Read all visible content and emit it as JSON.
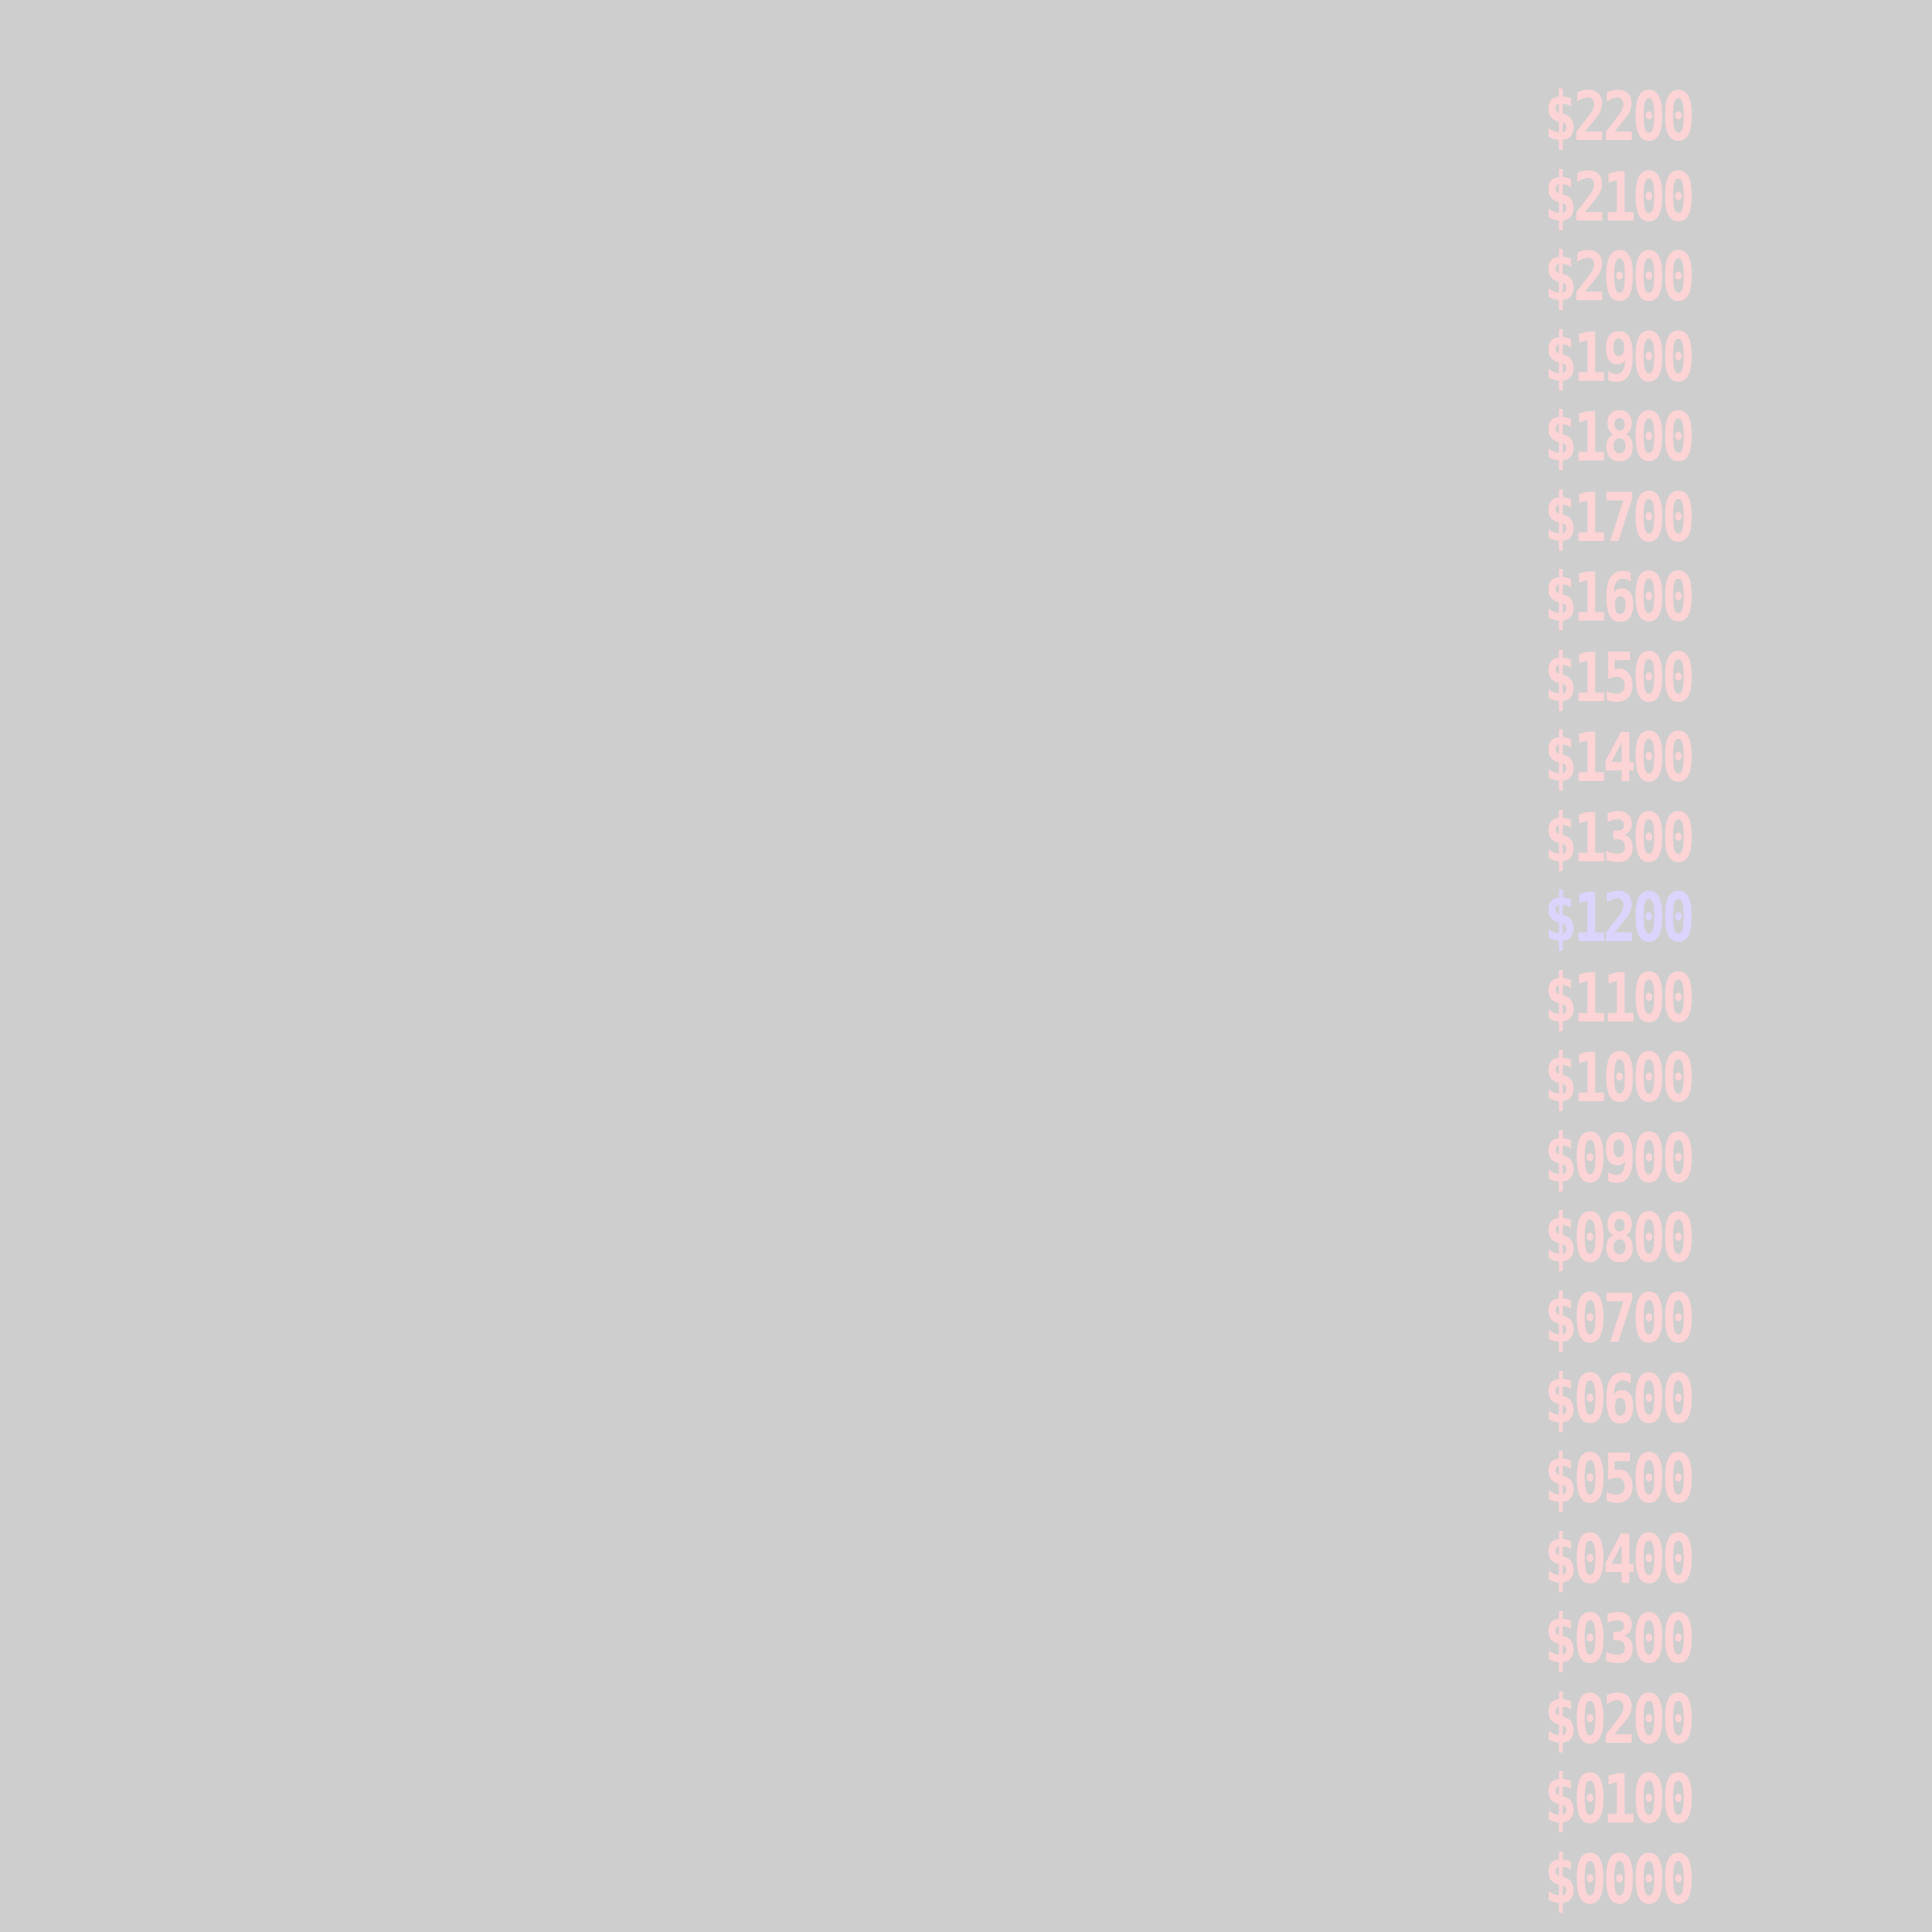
{
  "ladder": {
    "rungs": [
      {
        "label": "$2200",
        "current": false
      },
      {
        "label": "$2100",
        "current": false
      },
      {
        "label": "$2000",
        "current": false
      },
      {
        "label": "$1900",
        "current": false
      },
      {
        "label": "$1800",
        "current": false
      },
      {
        "label": "$1700",
        "current": false
      },
      {
        "label": "$1600",
        "current": false
      },
      {
        "label": "$1500",
        "current": false
      },
      {
        "label": "$1400",
        "current": false
      },
      {
        "label": "$1300",
        "current": false
      },
      {
        "label": "$1200",
        "current": true
      },
      {
        "label": "$1100",
        "current": false
      },
      {
        "label": "$1000",
        "current": false
      },
      {
        "label": "$0900",
        "current": false
      },
      {
        "label": "$0800",
        "current": false
      },
      {
        "label": "$0700",
        "current": false
      },
      {
        "label": "$0600",
        "current": false
      },
      {
        "label": "$0500",
        "current": false
      },
      {
        "label": "$0400",
        "current": false
      },
      {
        "label": "$0300",
        "current": false
      },
      {
        "label": "$0200",
        "current": false
      },
      {
        "label": "$0100",
        "current": false
      },
      {
        "label": "$0000",
        "current": false
      }
    ]
  },
  "colors": {
    "background": "#cecece",
    "rung": "#fcd4d6",
    "current_rung": "#dcd4fc"
  }
}
